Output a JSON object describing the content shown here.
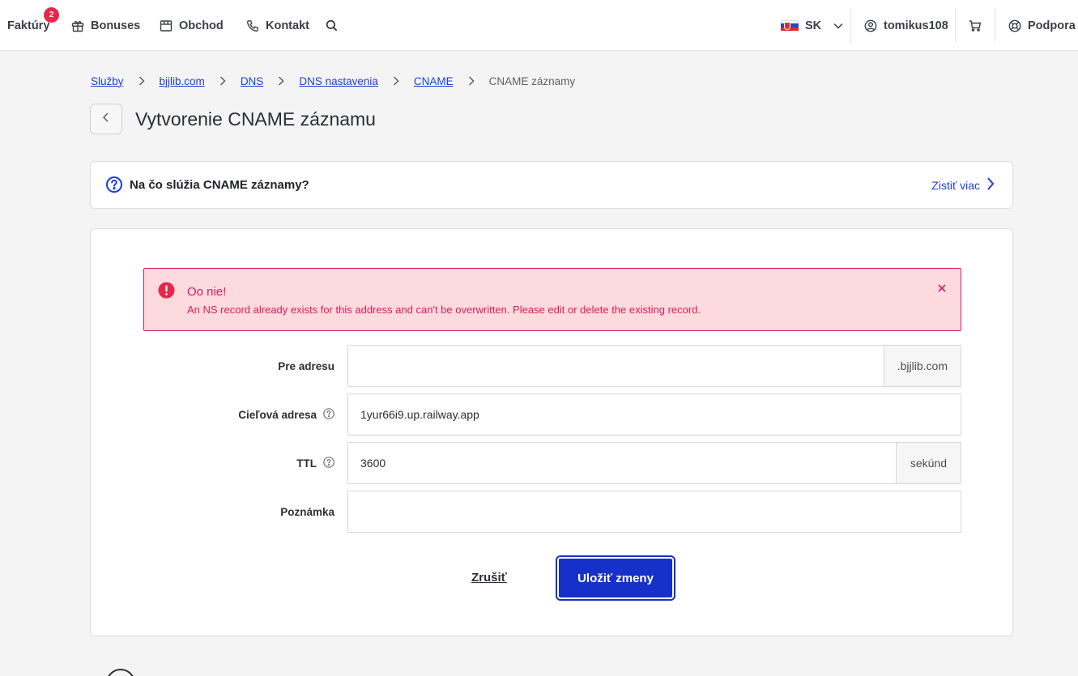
{
  "topbar": {
    "invoices_label": "Faktúry",
    "invoices_badge": "2",
    "bonuses_label": "Bonuses",
    "shop_label": "Obchod",
    "contact_label": "Kontakt",
    "language_code": "SK",
    "username": "tomikus108",
    "support_label": "Podpora"
  },
  "breadcrumb": {
    "items": [
      "Služby",
      "bjjlib.com",
      "DNS",
      "DNS nastavenia",
      "CNAME"
    ],
    "current": "CNAME záznamy"
  },
  "page": {
    "title": "Vytvorenie CNAME záznamu"
  },
  "info": {
    "title": "Na čo slúžia CNAME záznamy?",
    "more_label": "Zistiť viac"
  },
  "alert": {
    "title": "Oo nie!",
    "message": "An NS record already exists for this address and can't be overwritten. Please edit or delete the existing record."
  },
  "form": {
    "address_label": "Pre adresu",
    "address_value": "",
    "address_suffix": ".bjjlib.com",
    "target_label": "Cieľová adresa",
    "target_value": "1yur66i9.up.railway.app",
    "ttl_label": "TTL",
    "ttl_value": "3600",
    "ttl_suffix": "sekúnd",
    "note_label": "Poznámka",
    "note_value": "",
    "cancel_label": "Zrušiť",
    "save_label": "Uložiť zmeny"
  },
  "colors": {
    "primary": "#1631c9",
    "link": "#1b3fd6",
    "error": "#d81b60",
    "error_bg": "#fddadd",
    "badge": "#e8264a"
  }
}
